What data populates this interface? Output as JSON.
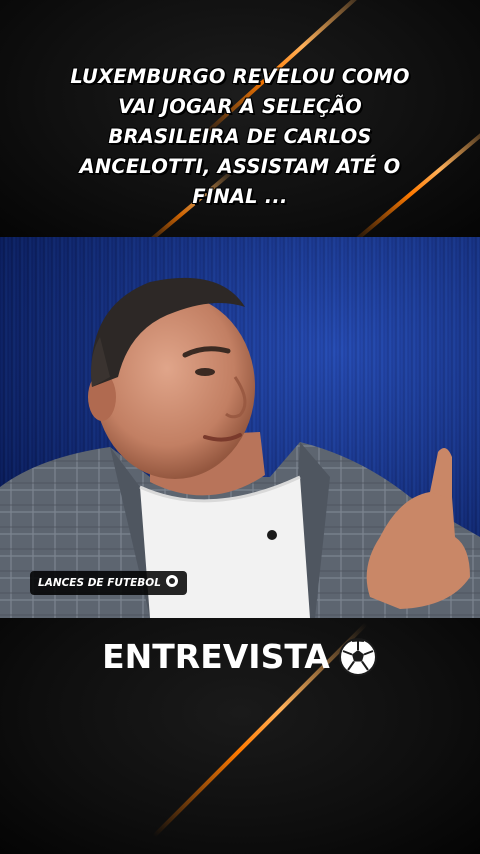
{
  "headline": {
    "line1": "LUXEMBURGO REVELOU COMO",
    "line2": "VAI JOGAR A SELEÇÃO",
    "line3": "BRASILEIRA DE CARLOS",
    "line4": "ANCELOTTI, ASSISTAM ATÉ O",
    "line5": "FINAL ..."
  },
  "video": {
    "watermark": "LANCES DE FUTEBOL"
  },
  "caption": {
    "text": "ENTREVISTA"
  },
  "icons": {
    "watermark_icon": "soccer-ball-icon",
    "caption_icon": "soccer-ball-icon"
  },
  "colors": {
    "accent_streak": "#ff7a00",
    "studio_blue": "#163a9e",
    "text": "#ffffff",
    "background": "#0b0b0b"
  }
}
